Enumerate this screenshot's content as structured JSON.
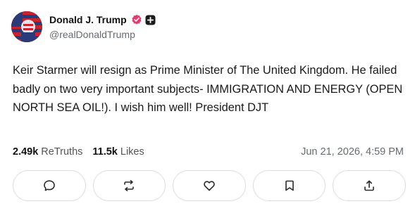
{
  "post": {
    "author_name": "Donald J. Trump",
    "handle": "@realDonaldTrump",
    "text": "Keir Starmer will resign as Prime Minister of The United Kingdom. He failed badly on two very important subjects- IMMIGRATION AND ENERGY (OPEN NORTH SEA OIL!). I wish him well! President DJT",
    "retruths_count": "2.49k",
    "retruths_label": "ReTruths",
    "likes_count": "11.5k",
    "likes_label": "Likes",
    "timestamp": "Jun 21, 2026, 4:59 PM"
  },
  "icons": {
    "verified": "verified-badge-icon",
    "plus": "plus-badge-icon",
    "reply": "reply-icon",
    "retruth": "retruth-icon",
    "like": "heart-icon",
    "bookmark": "bookmark-icon",
    "share": "share-icon"
  },
  "colors": {
    "verified": "#e33b6e",
    "border": "#dadde2",
    "secondary_text": "#666a70"
  }
}
